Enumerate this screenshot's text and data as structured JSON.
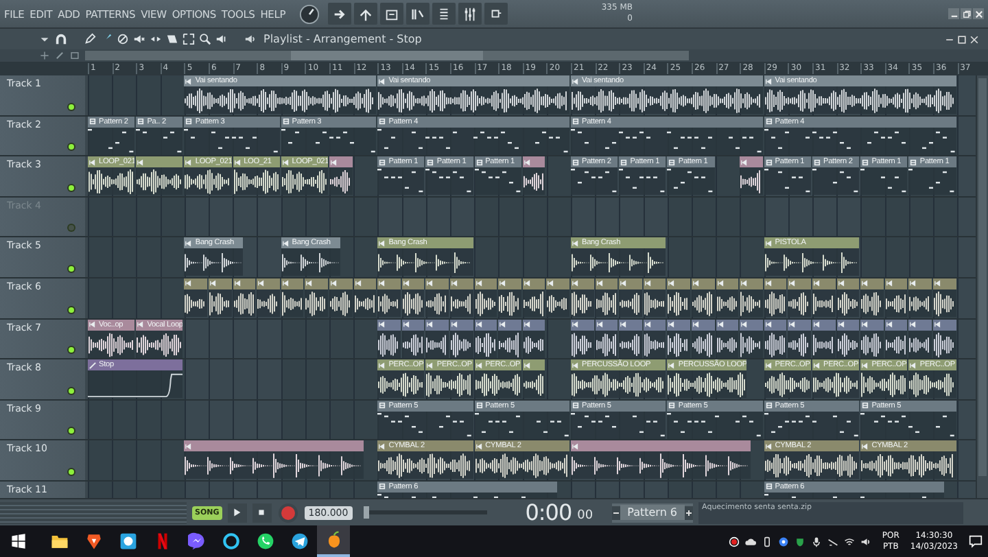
{
  "menu": [
    "FILE",
    "EDIT",
    "ADD",
    "PATTERNS",
    "VIEW",
    "OPTIONS",
    "TOOLS",
    "HELP"
  ],
  "memory": {
    "usage": "335 MB",
    "cpu": "0"
  },
  "playlist": {
    "title": "Playlist - Arrangement - Stop"
  },
  "ruler": [
    "1",
    "2",
    "3",
    "4",
    "5",
    "6",
    "7",
    "8",
    "9",
    "10",
    "11",
    "12",
    "13",
    "14",
    "15",
    "16",
    "17",
    "18",
    "19",
    "20",
    "21",
    "22",
    "23",
    "24",
    "25",
    "26",
    "27",
    "28",
    "29",
    "30",
    "31",
    "32",
    "33",
    "34",
    "35",
    "36",
    "37"
  ],
  "tracks": [
    {
      "name": "Track 1",
      "muted": false,
      "clips": [
        {
          "kind": "audio",
          "name": "Vai sentando",
          "color": "#7d8b93"
        },
        {
          "kind": "audio",
          "name": "Vai sentando",
          "color": "#7d8b93"
        },
        {
          "kind": "audio",
          "name": "Vai sentando",
          "color": "#7d8b93"
        },
        {
          "kind": "audio",
          "name": "Vai sentando",
          "color": "#7d8b93"
        }
      ]
    },
    {
      "name": "Track 2",
      "muted": false,
      "clips": [
        {
          "kind": "pattern",
          "name": "Pattern 2",
          "color": "#6c7a83"
        },
        {
          "kind": "pattern",
          "name": "Pa.. 2",
          "color": "#6c7a83"
        },
        {
          "kind": "pattern",
          "name": "Pattern 3",
          "color": "#6c7a83"
        },
        {
          "kind": "pattern",
          "name": "Pattern 3",
          "color": "#6c7a83"
        },
        {
          "kind": "pattern",
          "name": "Pattern 4",
          "color": "#6c7a83"
        },
        {
          "kind": "pattern",
          "name": "Pattern 4",
          "color": "#6c7a83"
        },
        {
          "kind": "pattern",
          "name": "Pattern 4",
          "color": "#6c7a83"
        }
      ]
    },
    {
      "name": "Track 3",
      "muted": false,
      "clips": [
        {
          "kind": "audio",
          "name": "LOOP_021",
          "color": "#8e9c72"
        },
        {
          "kind": "audio",
          "color": "#8e9c72"
        },
        {
          "kind": "audio",
          "name": "LOOP_021",
          "color": "#8e9c72"
        },
        {
          "kind": "audio",
          "name": "LOO_21",
          "color": "#8e9c72"
        },
        {
          "kind": "audio",
          "name": "LOOP_021",
          "color": "#8e9c72"
        },
        {
          "kind": "audio",
          "color": "#a98a9c"
        },
        {
          "kind": "pattern",
          "name": "Pattern 1",
          "color": "#6c7a83"
        },
        {
          "kind": "pattern",
          "name": "Pattern 1",
          "color": "#6c7a83"
        },
        {
          "kind": "pattern",
          "name": "Pattern 1",
          "color": "#6c7a83"
        },
        {
          "kind": "audio",
          "color": "#a98a9c"
        },
        {
          "kind": "pattern",
          "name": "Pattern 2",
          "color": "#6c7a83"
        },
        {
          "kind": "pattern",
          "name": "Pattern 1",
          "color": "#6c7a83"
        },
        {
          "kind": "pattern",
          "name": "Pattern 1",
          "color": "#6c7a83"
        },
        {
          "kind": "audio",
          "color": "#a98a9c"
        },
        {
          "kind": "pattern",
          "name": "Pattern 1",
          "color": "#6c7a83"
        },
        {
          "kind": "pattern",
          "name": "Pattern 2",
          "color": "#6c7a83"
        },
        {
          "kind": "pattern",
          "name": "Pattern 1",
          "color": "#6c7a83"
        },
        {
          "kind": "pattern",
          "name": "Pattern 1",
          "color": "#6c7a83"
        }
      ]
    },
    {
      "name": "Track 4",
      "muted": true
    },
    {
      "name": "Track 5",
      "muted": false,
      "clips": [
        {
          "kind": "oneshot",
          "name": "Bang Crash",
          "color": "#7d8b93"
        },
        {
          "kind": "oneshot",
          "name": "Bang Crash",
          "color": "#7d8b93"
        },
        {
          "kind": "oneshot",
          "name": "Bang Crash",
          "color": "#8e9c72"
        },
        {
          "kind": "oneshot",
          "name": "Bang Crash",
          "color": "#8e9c72"
        },
        {
          "kind": "oneshot",
          "name": "PISTOLA",
          "color": "#8e9c72"
        }
      ]
    },
    {
      "name": "Track 6",
      "muted": false,
      "clips": [
        {
          "kind": "audio",
          "color": "#8a8a6c"
        },
        {
          "kind": "audio",
          "color": "#8a8a6c"
        },
        {
          "kind": "audio",
          "color": "#8a8a6c"
        },
        {
          "kind": "audio",
          "color": "#8a8a6c"
        },
        {
          "kind": "audio",
          "color": "#8a8a6c"
        },
        {
          "kind": "audio",
          "color": "#8a8a6c"
        },
        {
          "kind": "audio",
          "color": "#8a8a6c"
        },
        {
          "kind": "audio",
          "color": "#8a8a6c"
        },
        {
          "kind": "audio",
          "color": "#8a8a6c"
        },
        {
          "kind": "audio",
          "color": "#8a8a6c"
        },
        {
          "kind": "audio",
          "color": "#8a8a6c"
        },
        {
          "kind": "audio",
          "color": "#8a8a6c"
        },
        {
          "kind": "audio",
          "color": "#8a8a6c"
        },
        {
          "kind": "audio",
          "color": "#8a8a6c"
        },
        {
          "kind": "audio",
          "color": "#8a8a6c"
        },
        {
          "kind": "audio",
          "color": "#8a8a6c"
        },
        {
          "kind": "audio",
          "color": "#8a8a6c"
        },
        {
          "kind": "audio",
          "color": "#8a8a6c"
        },
        {
          "kind": "audio",
          "color": "#8a8a6c"
        },
        {
          "kind": "audio",
          "color": "#8a8a6c"
        },
        {
          "kind": "audio",
          "color": "#8a8a6c"
        },
        {
          "kind": "audio",
          "color": "#8a8a6c"
        },
        {
          "kind": "audio",
          "color": "#8a8a6c"
        },
        {
          "kind": "audio",
          "color": "#8a8a6c"
        },
        {
          "kind": "audio",
          "color": "#8a8a6c"
        },
        {
          "kind": "audio",
          "color": "#8a8a6c"
        },
        {
          "kind": "audio",
          "color": "#8a8a6c"
        },
        {
          "kind": "audio",
          "color": "#8a8a6c"
        },
        {
          "kind": "audio",
          "color": "#8a8a6c"
        },
        {
          "kind": "audio",
          "color": "#8a8a6c"
        },
        {
          "kind": "audio",
          "color": "#8a8a6c"
        },
        {
          "kind": "audio",
          "color": "#8a8a6c"
        }
      ]
    },
    {
      "name": "Track 7",
      "muted": false,
      "clips": [
        {
          "kind": "audio",
          "name": "Voc..op",
          "color": "#a98a9c"
        },
        {
          "kind": "audio",
          "name": "Vocal Loop",
          "color": "#a98a9c"
        },
        {
          "kind": "audio",
          "color": "#6f7a94"
        },
        {
          "kind": "audio",
          "color": "#6f7a94"
        },
        {
          "kind": "audio",
          "color": "#6f7a94"
        },
        {
          "kind": "audio",
          "color": "#6f7a94"
        },
        {
          "kind": "audio",
          "color": "#6f7a94"
        },
        {
          "kind": "audio",
          "color": "#6f7a94"
        },
        {
          "kind": "audio",
          "color": "#6f7a94"
        },
        {
          "kind": "audio",
          "color": "#6f7a94"
        },
        {
          "kind": "audio",
          "color": "#6f7a94"
        },
        {
          "kind": "audio",
          "color": "#6f7a94"
        },
        {
          "kind": "audio",
          "color": "#6f7a94"
        },
        {
          "kind": "audio",
          "color": "#6f7a94"
        },
        {
          "kind": "audio",
          "color": "#6f7a94"
        },
        {
          "kind": "audio",
          "color": "#6f7a94"
        },
        {
          "kind": "audio",
          "color": "#6f7a94"
        },
        {
          "kind": "audio",
          "color": "#6f7a94"
        },
        {
          "kind": "audio",
          "color": "#6f7a94"
        },
        {
          "kind": "audio",
          "color": "#6f7a94"
        },
        {
          "kind": "audio",
          "color": "#6f7a94"
        },
        {
          "kind": "audio",
          "color": "#6f7a94"
        },
        {
          "kind": "audio",
          "color": "#6f7a94"
        },
        {
          "kind": "audio",
          "color": "#6f7a94"
        },
        {
          "kind": "audio",
          "color": "#6f7a94"
        }
      ]
    },
    {
      "name": "Track 8",
      "muted": false,
      "clips": [
        {
          "kind": "automation",
          "name": "Stop",
          "color": "#7d6f9c"
        },
        {
          "kind": "audio",
          "name": "PERC..OP",
          "color": "#8e9c72"
        },
        {
          "kind": "audio",
          "name": "PERC..OP",
          "color": "#8e9c72"
        },
        {
          "kind": "audio",
          "name": "PERC..OP",
          "color": "#8e9c72"
        },
        {
          "kind": "audio",
          "color": "#8e9c72"
        },
        {
          "kind": "audio",
          "name": "PERCUSSÃO LOOP",
          "color": "#8e9c72"
        },
        {
          "kind": "audio",
          "name": "PERCUSSÃO LOOP",
          "color": "#8e9c72"
        },
        {
          "kind": "audio",
          "name": "PERC..OP",
          "color": "#8e9c72"
        },
        {
          "kind": "audio",
          "name": "PERC..OP",
          "color": "#8e9c72"
        },
        {
          "kind": "audio",
          "name": "PERC..OP",
          "color": "#8e9c72"
        },
        {
          "kind": "audio",
          "name": "PERC..OP",
          "color": "#8e9c72"
        }
      ]
    },
    {
      "name": "Track 9",
      "muted": false,
      "clips": [
        {
          "kind": "pattern",
          "name": "Pattern 5",
          "color": "#6c7a83"
        },
        {
          "kind": "pattern",
          "name": "Pattern 5",
          "color": "#6c7a83"
        },
        {
          "kind": "pattern",
          "name": "Pattern 5",
          "color": "#6c7a83"
        },
        {
          "kind": "pattern",
          "name": "Pattern 5",
          "color": "#6c7a83"
        },
        {
          "kind": "pattern",
          "name": "Pattern 5",
          "color": "#6c7a83"
        },
        {
          "kind": "pattern",
          "name": "Pattern 5",
          "color": "#6c7a83"
        }
      ]
    },
    {
      "name": "Track 10",
      "muted": false,
      "clips": [
        {
          "kind": "oneshot",
          "color": "#a98a9c"
        },
        {
          "kind": "audio",
          "name": "CYMBAL 2",
          "color": "#8a8a6c"
        },
        {
          "kind": "audio",
          "name": "CYMBAL 2",
          "color": "#8a8a6c"
        },
        {
          "kind": "oneshot",
          "color": "#a98a9c"
        },
        {
          "kind": "audio",
          "name": "CYMBAL 2",
          "color": "#8a8a6c"
        },
        {
          "kind": "audio",
          "name": "CYMBAL 2",
          "color": "#8a8a6c"
        }
      ]
    },
    {
      "name": "Track 11",
      "muted": false,
      "clips": [
        {
          "kind": "pattern",
          "name": "Pattern 6",
          "color": "#6c7a83"
        },
        {
          "kind": "pattern",
          "name": "Pattern 6",
          "color": "#6c7a83"
        }
      ]
    }
  ],
  "transport": {
    "mode": "SONG",
    "tempo": "180.000",
    "position": {
      "level": 0
    },
    "time": "0:00",
    "time_fraction": "00",
    "pattern": "Pattern 6",
    "hint": "Aquecimento senta senta.zip"
  },
  "taskbar": {
    "apps": [
      {
        "kind": "folder",
        "selected": false
      },
      {
        "kind": "shield",
        "selected": false
      },
      {
        "kind": "square",
        "selected": false
      },
      {
        "kind": "ribbon",
        "selected": false
      },
      {
        "kind": "chat",
        "selected": false
      },
      {
        "kind": "ring",
        "selected": false
      },
      {
        "kind": "phone",
        "selected": false
      },
      {
        "kind": "plane",
        "selected": false
      },
      {
        "kind": "fruit",
        "selected": true
      }
    ],
    "language": "POR",
    "layout": "PTB",
    "time": "14:30:30",
    "date": "14/03/2023"
  }
}
